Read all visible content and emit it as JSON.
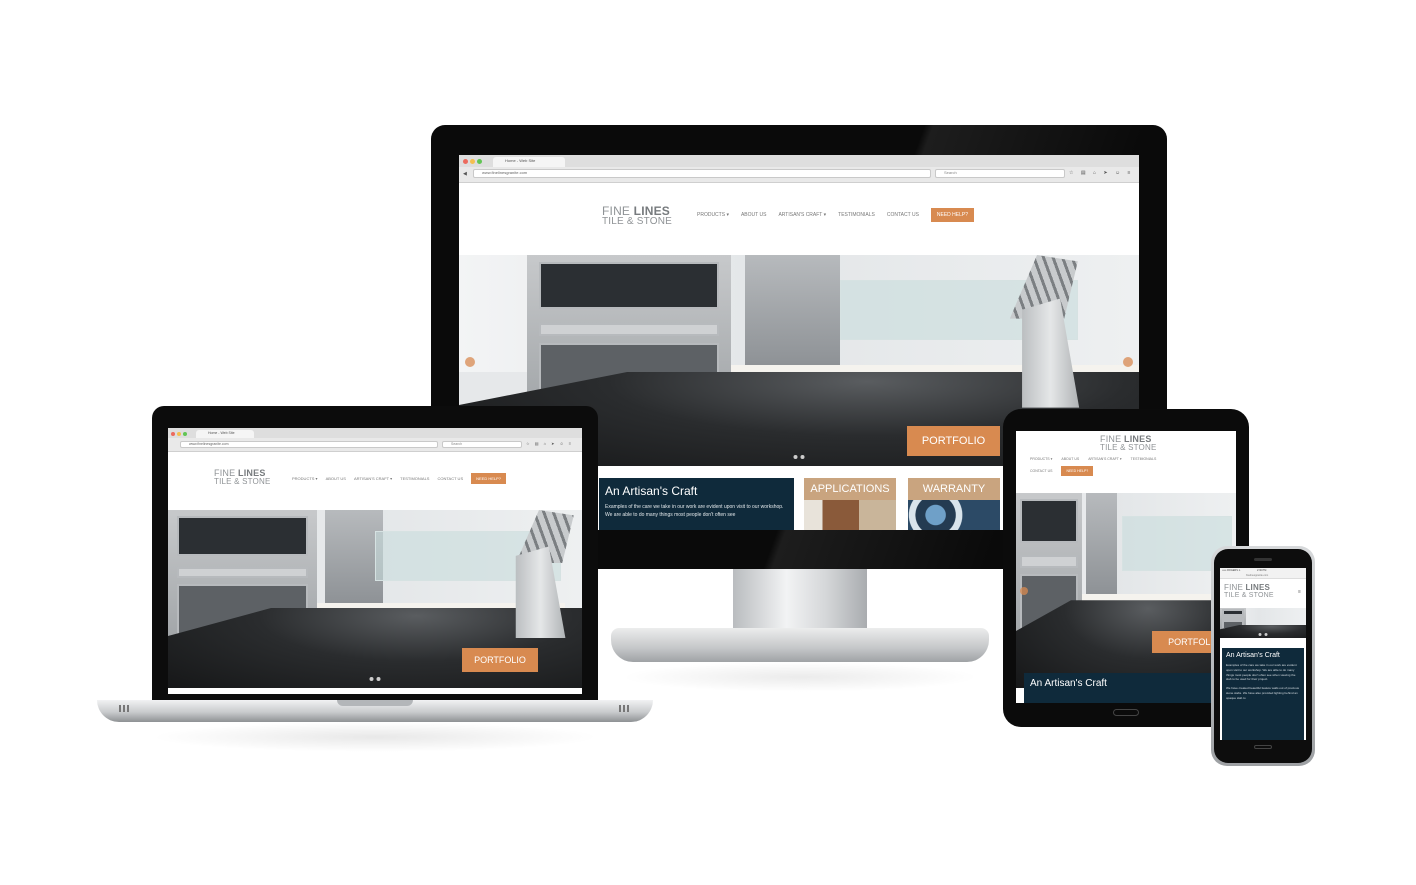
{
  "site": {
    "logo_line1_a": "FINE ",
    "logo_line1_b": "LINES",
    "logo_line2": "TILE & STONE",
    "nav": {
      "products": "PRODUCTS ▾",
      "about": "ABOUT US",
      "craft": "ARTISAN'S CRAFT ▾",
      "testimonials": "TESTIMONIALS",
      "contact": "CONTACT US",
      "help": "NEED HELP?"
    },
    "hero_button": "PORTFOLIO",
    "craft_heading": "An Artisan's Craft",
    "craft_text": "Examples of the care we take in our work are evident upon visit to our workshop. We are able to do many things most people don't often see",
    "phone_craft_text": "Examples of the care we take in our work are evident upon visit to our workshop. We are able to do many things most people don't often see when viewing the slab to be used for their project.",
    "phone_craft_text2": "We have created beautiful feature walls out of precious stone slabs. We have also provided lighting behind an opaque slab to",
    "applications": "APPLICATIONS",
    "warranty": "WARRANTY"
  },
  "browser": {
    "tab_title": "Home - Web Site",
    "url": "www.finelinesgranite.com",
    "search_placeholder": "Search",
    "toolbar_icons": "☆ ▤ ⌂ ➤ ☺ ≡"
  },
  "phone_status": {
    "carrier": "••••• ROGERS ✈",
    "time": "2:30 PM",
    "url": "finelinesgranite.com"
  },
  "colors": {
    "accent": "#d88a50",
    "navy": "#0f2a3b",
    "tan": "#c9a47f"
  }
}
